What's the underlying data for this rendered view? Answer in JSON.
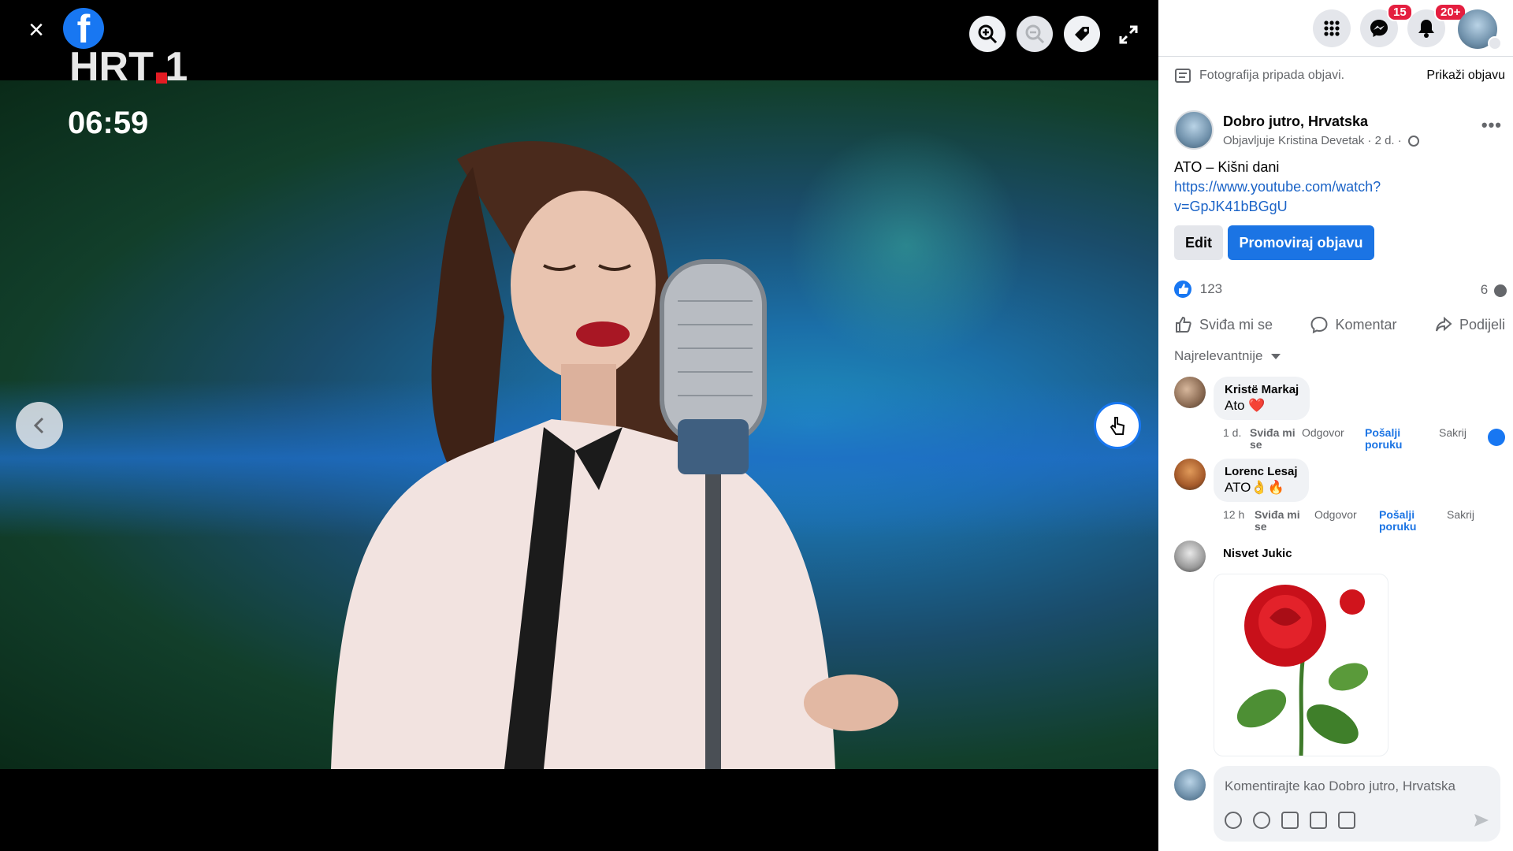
{
  "viewer": {
    "logo_text": "f",
    "channel_logo": "HRT 1",
    "clock": "06:59",
    "close_label": "×"
  },
  "sidebar": {
    "badges": {
      "messenger": "15",
      "notifications": "20+"
    },
    "notice": {
      "text": "Fotografija pripada objavi.",
      "link": "Prikaži objavu"
    },
    "post": {
      "page_name": "Dobro jutro, Hrvatska",
      "byline": "Objavljuje Kristina Devetak · 2 d. ·",
      "text_line": "ATO – Kišni dani",
      "link": "https://www.youtube.com/watch?v=GpJK41bBGgU",
      "link_line1": "https://www.youtube.com/watch?",
      "link_line2": "v=GpJK41bBGgU",
      "edit_label": "Edit",
      "promote_label": "Promoviraj objavu",
      "like_count": "123",
      "comment_count": "6",
      "actions": {
        "like": "Sviđa mi se",
        "comment": "Komentar",
        "share": "Podijeli"
      },
      "sort_label": "Najrelevantnije"
    },
    "comments": [
      {
        "name": "Kristë Markaj",
        "text": "Ato ❤️",
        "time": "1 d.",
        "like": "Sviđa mi se",
        "reply": "Odgovor",
        "send": "Pošalji poruku",
        "hide": "Sakrij"
      },
      {
        "name": "Lorenc Lesaj",
        "text": "ATO👌🔥",
        "time": "12 h",
        "like": "Sviđa mi se",
        "reply": "Odgovor",
        "send": "Pošalji poruku",
        "hide": "Sakrij"
      },
      {
        "name": "Nisvet Jukic"
      }
    ],
    "composer": {
      "placeholder": "Komentirajte kao Dobro jutro, Hrvatska"
    }
  },
  "colors": {
    "fb_blue": "#1877f2",
    "badge_red": "#e41e3f",
    "link_blue": "#1c64c7"
  }
}
